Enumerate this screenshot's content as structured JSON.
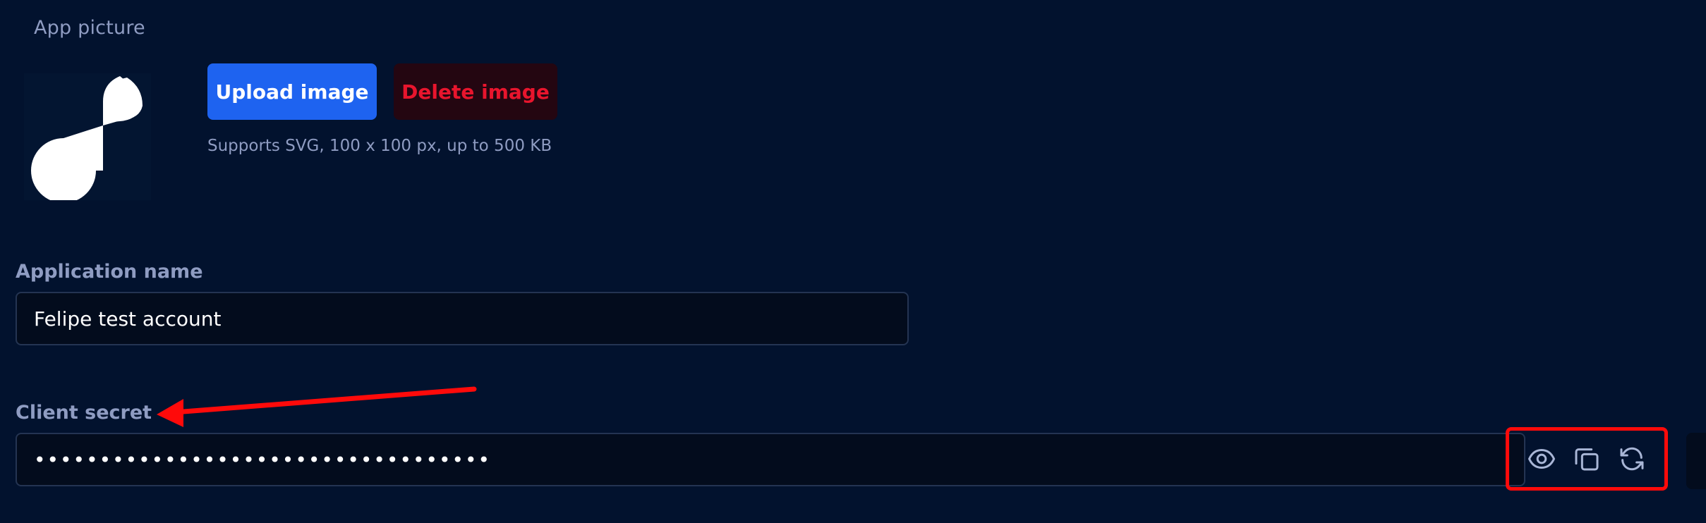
{
  "app_picture": {
    "label": "App picture",
    "upload_label": "Upload image",
    "delete_label": "Delete image",
    "hint": "Supports SVG, 100 x 100 px, up to 500 KB"
  },
  "application_name": {
    "label": "Application name",
    "value": "Felipe test account"
  },
  "client_secret": {
    "label": "Client secret",
    "value": "•••••••••••••••••••••••••••••••••••",
    "actions": [
      "eye-icon",
      "copy-icon",
      "refresh-icon"
    ]
  },
  "colors": {
    "background": "#02122e",
    "primary": "#1e63f0",
    "danger": "#e8152d",
    "annotation": "#ff0a0a"
  }
}
